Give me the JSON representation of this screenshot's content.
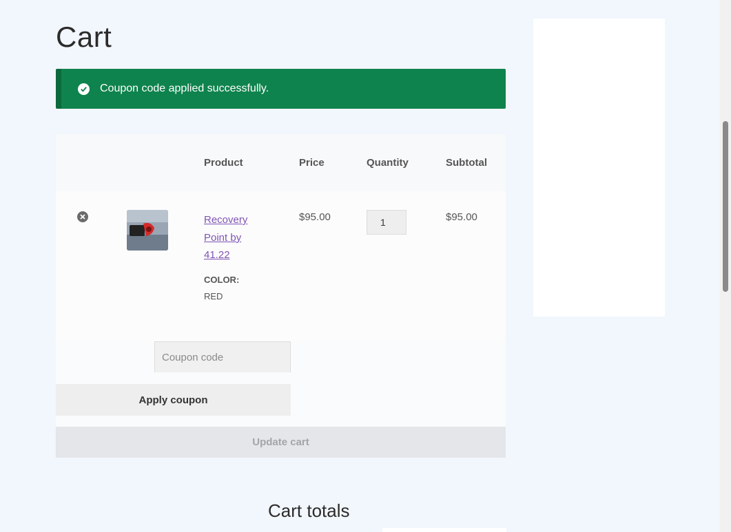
{
  "page": {
    "title": "Cart"
  },
  "notice": {
    "message": "Coupon code applied successfully."
  },
  "table": {
    "headers": {
      "product": "Product",
      "price": "Price",
      "quantity": "Quantity",
      "subtotal": "Subtotal"
    },
    "rows": [
      {
        "product_line1": "Recovery",
        "product_line2": "Point by",
        "product_line3": "41.22",
        "variation_label": "COLOR:",
        "variation_value": "RED",
        "price": "$95.00",
        "quantity": "1",
        "subtotal": "$95.00"
      }
    ]
  },
  "coupon": {
    "placeholder": "Coupon code",
    "apply_label": "Apply coupon"
  },
  "update": {
    "label": "Update cart"
  },
  "totals": {
    "title": "Cart totals"
  },
  "colors": {
    "notice_bg": "#0f834d",
    "link": "#7f54b3",
    "page_bg": "#f2f6fd"
  },
  "icons": {
    "notice": "check-circle-icon",
    "remove": "remove-x-icon"
  }
}
